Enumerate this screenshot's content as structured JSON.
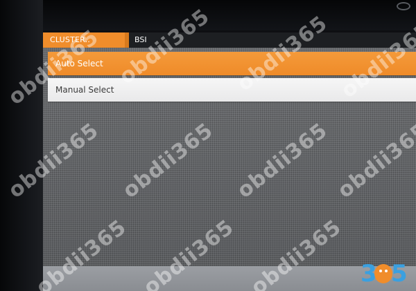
{
  "header": {
    "active_tab": "CLUSTER..",
    "second_tab": "BSI"
  },
  "list": {
    "items": [
      {
        "label": "Auto Select",
        "selected": true
      },
      {
        "label": "Manual Select",
        "selected": false
      }
    ]
  },
  "watermark": {
    "text": "obdii365"
  },
  "logo": {
    "digit_left": "3",
    "digit_right": "5"
  },
  "colors": {
    "accent": "#f08d2b",
    "logo_blue": "#3aa0e0"
  }
}
